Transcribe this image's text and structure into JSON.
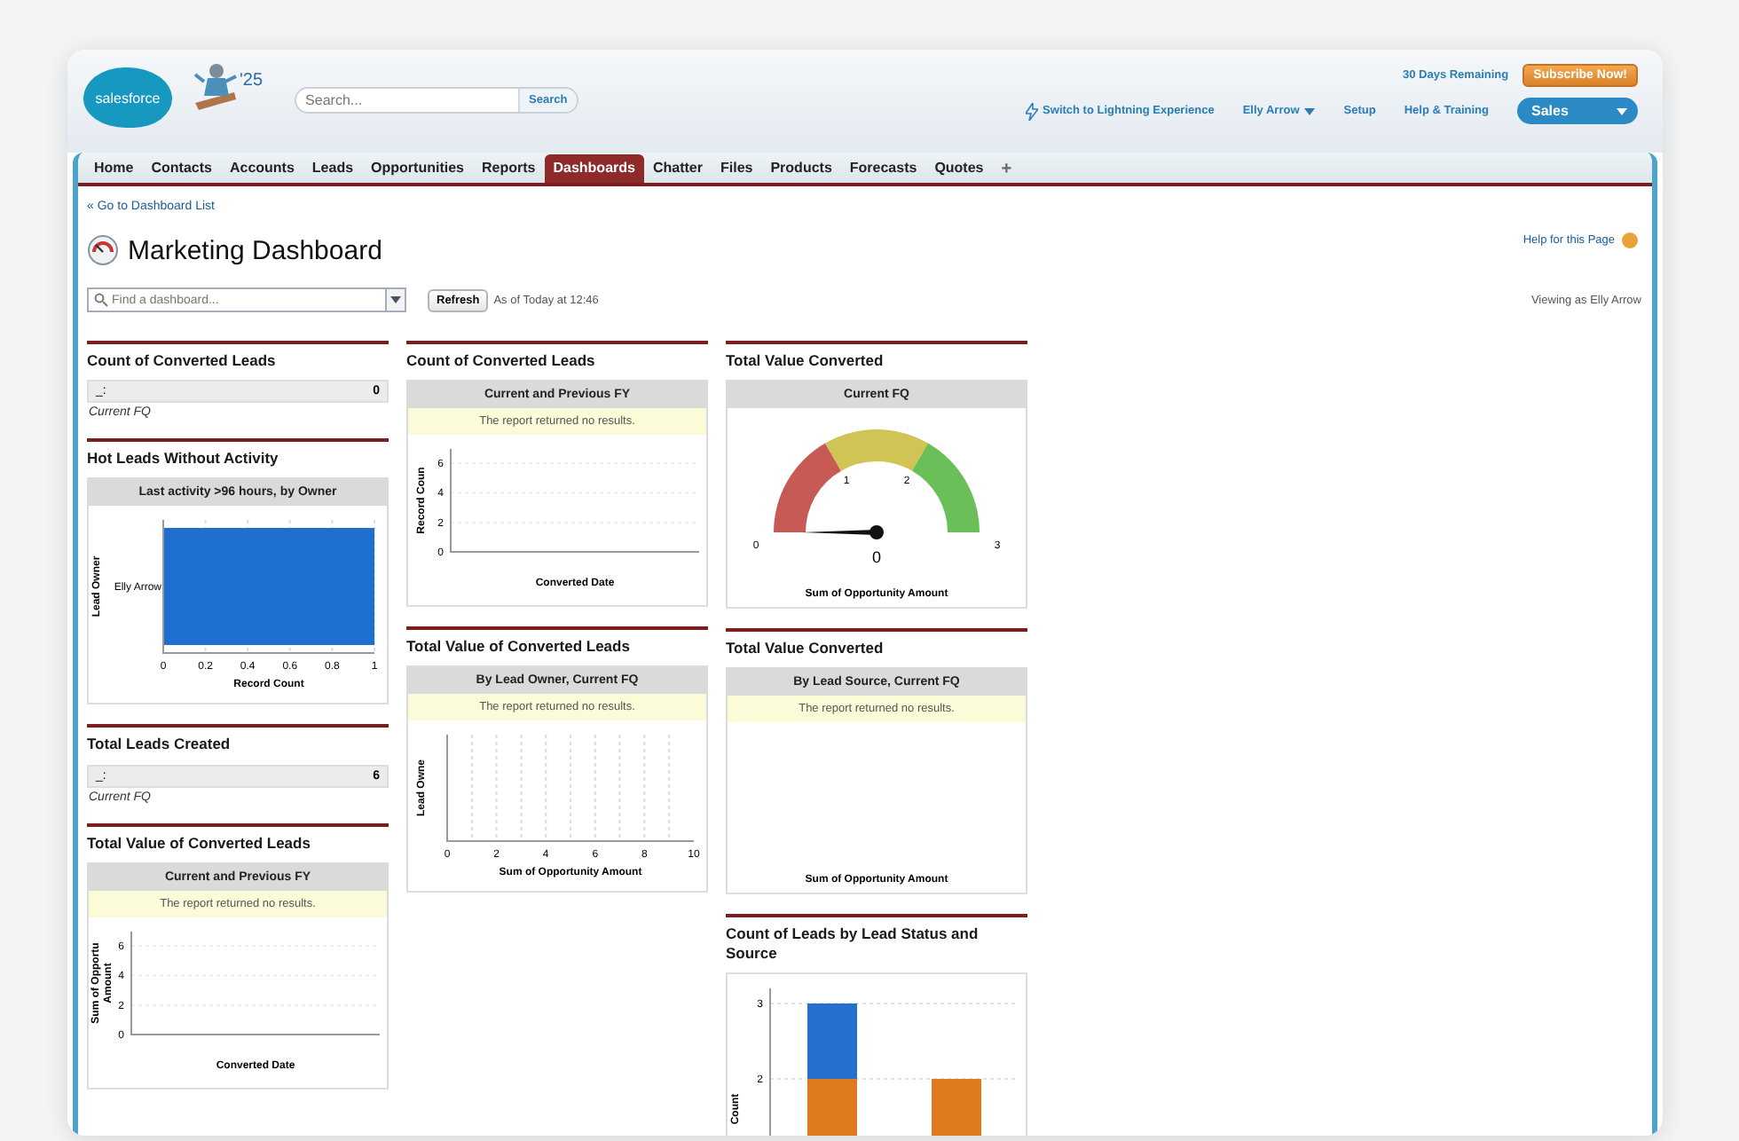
{
  "header": {
    "logo": "salesforce",
    "badge": "'25",
    "search": {
      "placeholder": "Search..."
    },
    "search_button": "Search",
    "trial": "30 Days Remaining",
    "subscribe": "Subscribe Now!",
    "links": [
      {
        "kind": "lightning",
        "label": "Switch to Lightning Experience"
      },
      {
        "kind": "menu",
        "label": "Elly Arrow"
      },
      {
        "kind": "plain",
        "label": "Setup"
      },
      {
        "kind": "plain",
        "label": "Help & Training"
      }
    ],
    "app_menu": "Sales"
  },
  "tabs": [
    {
      "label": "Home",
      "selected": false
    },
    {
      "label": "Contacts",
      "selected": false
    },
    {
      "label": "Accounts",
      "selected": false
    },
    {
      "label": "Leads",
      "selected": false
    },
    {
      "label": "Opportunities",
      "selected": false
    },
    {
      "label": "Reports",
      "selected": false
    },
    {
      "label": "Dashboards",
      "selected": true
    },
    {
      "label": "Chatter",
      "selected": false
    },
    {
      "label": "Files",
      "selected": false
    },
    {
      "label": "Products",
      "selected": false
    },
    {
      "label": "Forecasts",
      "selected": false
    },
    {
      "label": "Quotes",
      "selected": false
    }
  ],
  "add_tab": "+",
  "back_link": "« Go to Dashboard List",
  "title": "Marketing Dashboard",
  "help_link": "Help for this Page",
  "dashboard_picker": {
    "placeholder": "Find a dashboard..."
  },
  "refresh": "Refresh",
  "as_of": "As of Today at 12:46",
  "viewing_as": "Viewing as Elly Arrow",
  "columns": [
    [
      {
        "kind": "metric",
        "title": "Count of Converted Leads",
        "label": "_:",
        "value": "0",
        "footer": "Current FQ"
      },
      {
        "kind": "chart",
        "title": "Hot Leads Without Activity",
        "subtitle": "Last activity >96 hours, by Owner",
        "chart_data": {
          "type": "bar",
          "orientation": "horizontal",
          "categories": [
            "Elly Arrow"
          ],
          "series": [
            {
              "color": "#1f6fcf",
              "values": [
                1
              ]
            }
          ],
          "grid": true,
          "xlim": [
            0,
            1
          ],
          "xticks": [
            0,
            0.2,
            0.4,
            0.6,
            0.8,
            1
          ],
          "xlabel": "Record Count",
          "ylabel": "Lead Owner"
        }
      },
      {
        "kind": "metric",
        "title": "Total Leads Created",
        "label": "_:",
        "value": "6",
        "footer": "Current FQ"
      },
      {
        "kind": "empty-chart",
        "title": "Total Value of Converted Leads",
        "subtitle": "Current and Previous FY",
        "message": "The report returned no results.",
        "yticks": [
          "6",
          "4",
          "2",
          "0"
        ],
        "xlabel": "Converted Date",
        "ylabel": "Sum of Opportu Amount"
      }
    ],
    [
      {
        "kind": "empty-chart",
        "title": "Count of Converted Leads",
        "subtitle": "Current and Previous FY",
        "message": "The report returned no results.",
        "yticks": [
          "6",
          "4",
          "2",
          "0"
        ],
        "xlabel": "Converted Date",
        "ylabel": "Record Coun"
      },
      {
        "kind": "empty-chart",
        "title": "Total Value of Converted Leads",
        "subtitle": "By Lead Owner, Current FQ",
        "message": "The report returned no results.",
        "xticks": [
          "0",
          "2",
          "4",
          "6",
          "8",
          "10"
        ],
        "xlabel": "Sum of Opportunity Amount",
        "ylabel": "Lead Owne"
      }
    ],
    [
      {
        "kind": "gauge",
        "title": "Total Value Converted",
        "subtitle": "Current FQ",
        "ticks": [
          "0",
          "1",
          "2",
          "3"
        ],
        "bands": [
          {
            "color": "#c85a55"
          },
          {
            "color": "#cfc454"
          },
          {
            "color": "#6bbf59"
          }
        ],
        "level": 0,
        "reading": "0",
        "xlabel": "Sum of Opportunity Amount"
      },
      {
        "kind": "empty-chart",
        "title": "Total Value Converted",
        "subtitle": "By Lead Source, Current FQ",
        "message": "The report returned no results.",
        "xlabel": "Sum of Opportunity Amount"
      },
      {
        "kind": "chart",
        "title": "Count of Leads by Lead Status and Source",
        "chart_data": {
          "type": "bar",
          "orientation": "vertical",
          "stacked": true,
          "grid": true,
          "ylim": [
            0,
            3.2
          ],
          "yticks": [
            2,
            3
          ],
          "ylabel": "Count",
          "series": [
            {
              "color": "#e07a1f",
              "values": [
                2,
                2
              ]
            },
            {
              "color": "#2470cc",
              "values": [
                1,
                null
              ]
            }
          ]
        }
      }
    ]
  ]
}
